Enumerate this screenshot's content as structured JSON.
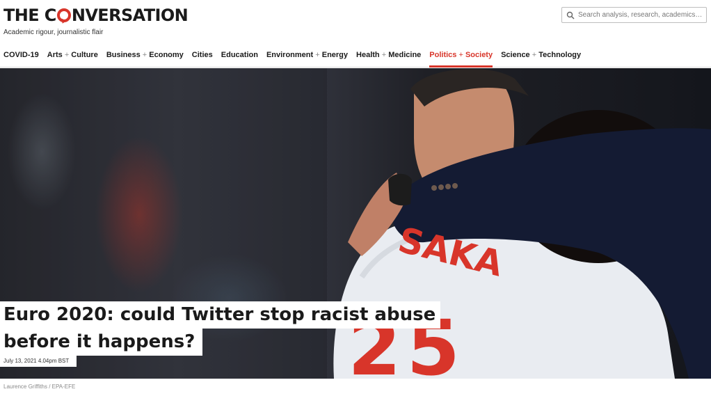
{
  "site": {
    "logo_before": "THE C",
    "logo_after": "NVERSATION",
    "tagline": "Academic rigour, journalistic flair"
  },
  "search": {
    "placeholder": "Search analysis, research, academics…"
  },
  "nav": {
    "items": [
      {
        "a": "COVID-19",
        "plus": "",
        "b": ""
      },
      {
        "a": "Arts ",
        "plus": "+",
        "b": " Culture"
      },
      {
        "a": "Business ",
        "plus": "+",
        "b": " Economy"
      },
      {
        "a": "Cities",
        "plus": "",
        "b": ""
      },
      {
        "a": "Education",
        "plus": "",
        "b": ""
      },
      {
        "a": "Environment ",
        "plus": "+",
        "b": " Energy"
      },
      {
        "a": "Health ",
        "plus": "+",
        "b": " Medicine"
      },
      {
        "a": "Politics ",
        "plus": "+",
        "b": " Society"
      },
      {
        "a": "Science ",
        "plus": "+",
        "b": " Technology"
      }
    ],
    "active_index": 7
  },
  "article": {
    "headline_line1": "Euro 2020: could Twitter stop racist abuse",
    "headline_line2": "before it happens?",
    "date": "July 13, 2021 4.04pm BST",
    "photo_credit": "Laurence Griffiths / EPA-EFE",
    "shirt_name": "SAKA"
  },
  "colors": {
    "accent": "#d8352a",
    "jacket": "#141b33",
    "shirt": "#e9ecf1"
  }
}
